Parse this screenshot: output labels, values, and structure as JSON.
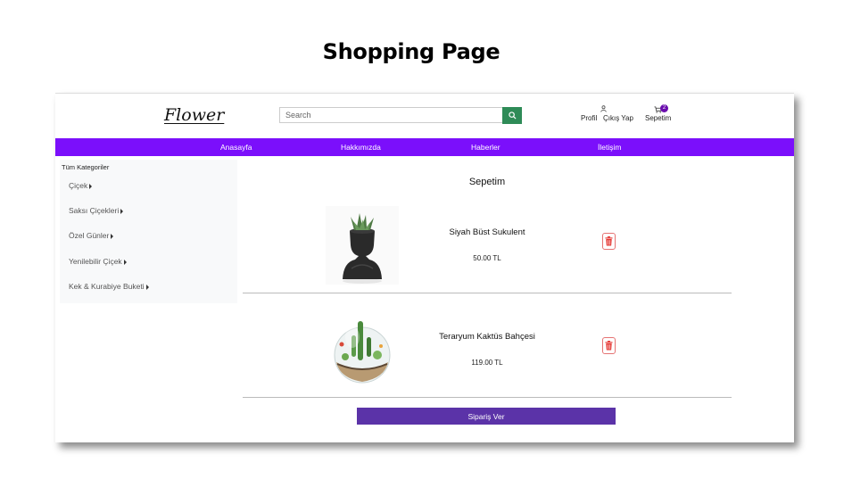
{
  "slide": {
    "title": "Shopping Page"
  },
  "header": {
    "logo": "Flower",
    "search": {
      "placeholder": "Search",
      "value": ""
    },
    "profile_label": "Profil",
    "logout_label": "Çıkış Yap",
    "cart_label": "Sepetim",
    "cart_count": "2"
  },
  "nav": {
    "items": [
      "Anasayfa",
      "Hakkımızda",
      "Haberler",
      "İletişim"
    ]
  },
  "sidebar": {
    "heading": "Tüm Kategoriler",
    "items": [
      "Çiçek",
      "Saksı Çiçekleri",
      "Özel Günler",
      "Yenilebilir Çiçek",
      "Kek & Kurabiye Buketi"
    ]
  },
  "cart": {
    "title": "Sepetim",
    "products": [
      {
        "name": "Siyah Büst Sukulent",
        "price": "50.00 TL",
        "image_icon": "black-bust-succulent-image"
      },
      {
        "name": "Teraryum Kaktüs Bahçesi",
        "price": "119.00 TL",
        "image_icon": "terrarium-cactus-image"
      }
    ],
    "order_button": "Sipariş Ver"
  },
  "colors": {
    "nav": "#7b0ffb",
    "search_button": "#2e8b57",
    "order_button": "#5b33a8",
    "delete": "#e53935",
    "badge": "#6a0dad"
  }
}
